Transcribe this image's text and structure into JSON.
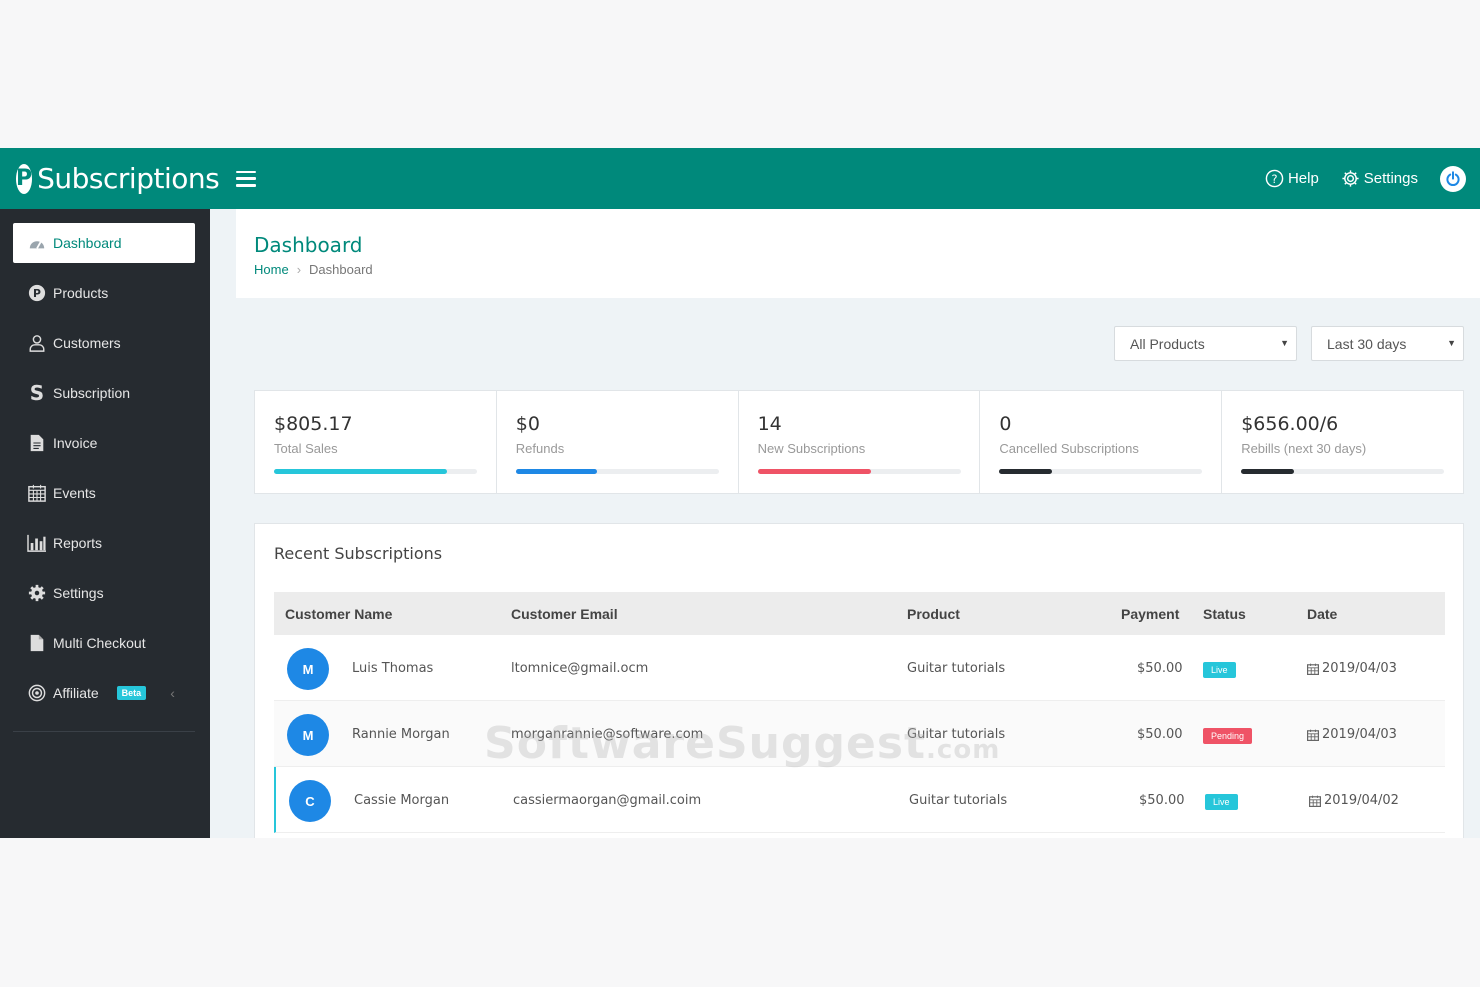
{
  "app": {
    "brand_letter": "P",
    "brand_name": "Subscriptions"
  },
  "topbar": {
    "help_label": "Help",
    "settings_label": "Settings"
  },
  "sidebar": {
    "items": [
      {
        "label": "Dashboard",
        "icon": "dashboard-icon",
        "active": true
      },
      {
        "label": "Products",
        "icon": "products-icon"
      },
      {
        "label": "Customers",
        "icon": "user-icon"
      },
      {
        "label": "Subscription",
        "icon": "subscription-icon"
      },
      {
        "label": "Invoice",
        "icon": "document-icon"
      },
      {
        "label": "Events",
        "icon": "calendar-icon"
      },
      {
        "label": "Reports",
        "icon": "bar-chart-icon"
      },
      {
        "label": "Settings",
        "icon": "gear-icon"
      },
      {
        "label": "Multi Checkout",
        "icon": "file-icon"
      },
      {
        "label": "Affiliate",
        "icon": "target-icon",
        "badge": "Beta"
      }
    ]
  },
  "page": {
    "title": "Dashboard",
    "breadcrumb_home": "Home",
    "breadcrumb_current": "Dashboard"
  },
  "filters": {
    "product_select": "All Products",
    "period_select": "Last 30 days"
  },
  "stats": [
    {
      "value": "$805.17",
      "label": "Total Sales",
      "progress": 0.85,
      "color": "#26c6da"
    },
    {
      "value": "$0",
      "label": "Refunds",
      "progress": 0.4,
      "color": "#1e88e5"
    },
    {
      "value": "14",
      "label": "New Subscriptions",
      "progress": 0.56,
      "color": "#ef5366"
    },
    {
      "value": "0",
      "label": "Cancelled Subscriptions",
      "progress": 0.26,
      "color": "#262b30"
    },
    {
      "value": "$656.00/6",
      "label": "Rebills (next 30 days)",
      "progress": 0.26,
      "color": "#262b30"
    }
  ],
  "recent": {
    "title": "Recent Subscriptions",
    "columns": [
      "Customer Name",
      "Customer Email",
      "Product",
      "Payment",
      "Status",
      "Date"
    ],
    "rows": [
      {
        "initial": "M",
        "name": "Luis Thomas",
        "email": "ltomnice@gmail.ocm",
        "product": "Guitar tutorials",
        "payment": "$50.00",
        "status": "Live",
        "date": "2019/04/03"
      },
      {
        "initial": "M",
        "name": "Rannie Morgan",
        "email": "morganrannie@software.com",
        "product": "Guitar tutorials",
        "payment": "$50.00",
        "status": "Pending",
        "date": "2019/04/03"
      },
      {
        "initial": "C",
        "name": "Cassie Morgan",
        "email": "cassiermaorgan@gmail.coim",
        "product": "Guitar tutorials",
        "payment": "$50.00",
        "status": "Live",
        "date": "2019/04/02"
      }
    ]
  },
  "colors": {
    "brand": "#00897b",
    "sidebar": "#262b30",
    "live": "#26c6da",
    "pending": "#ef5366",
    "avatar": "#1e88e5"
  },
  "watermark": {
    "text": "SoftwareSuggest",
    "suffix": ".com"
  }
}
